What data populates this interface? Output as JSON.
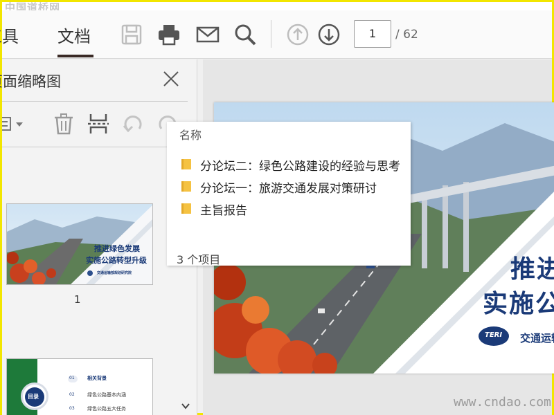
{
  "watermark_top": "中国道桥网",
  "watermark_bottom": "www.cndao.com",
  "menu": {
    "tools": "工具",
    "document": "文档"
  },
  "toolbar": {
    "icons": [
      "save-icon",
      "print-icon",
      "email-icon",
      "search-icon",
      "page-up-icon",
      "page-down-icon"
    ],
    "page_current": "1",
    "page_total": "/ 62"
  },
  "sidebar": {
    "title": "页面缩略图",
    "tools": [
      "page-options-icon",
      "delete-icon",
      "extract-icon",
      "undo-icon",
      "redo-icon"
    ],
    "thumbnails": [
      {
        "number": "1",
        "title_line1": "推进绿色发展",
        "title_line2": "实施公路转型升级",
        "org": "交通运输部规划研究院"
      },
      {
        "number": "",
        "toc_title": "目录",
        "toc_items": [
          "相关背景",
          "绿色公路基本内涵",
          "绿色公路五大任务"
        ],
        "toc_numbers": [
          "01",
          "02",
          "03"
        ]
      }
    ]
  },
  "popup": {
    "header": "名称",
    "items": [
      {
        "label": "分论坛二：绿色公路建设的经验与思考"
      },
      {
        "label": "分论坛一：旅游交通发展对策研讨"
      },
      {
        "label": "主旨报告"
      }
    ],
    "count": "3 个项目"
  },
  "page_view": {
    "title_line1": "推进",
    "title_line2": "实施公",
    "org": "交通运输",
    "logo_text": "TERI"
  },
  "colors": {
    "accent": "#1a3a78",
    "folder": "#f5c242",
    "border": "#f2e600"
  }
}
